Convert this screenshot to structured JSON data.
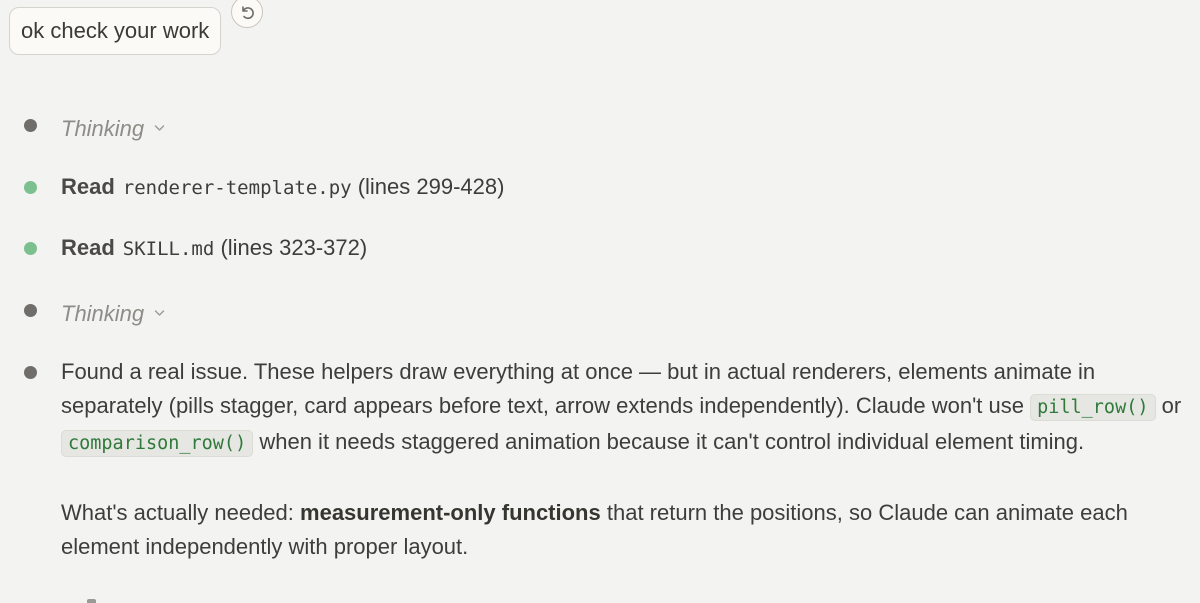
{
  "user_message": {
    "text": "ok check your work"
  },
  "steps": [
    {
      "kind": "thinking",
      "label": "Thinking"
    },
    {
      "kind": "read",
      "label": "Read",
      "file": "renderer-template.py",
      "range": "(lines 299-428)"
    },
    {
      "kind": "read",
      "label": "Read",
      "file": "SKILL.md",
      "range": "(lines 323-372)"
    },
    {
      "kind": "thinking",
      "label": "Thinking"
    }
  ],
  "response": {
    "p1_a": "Found a real issue. These helpers draw everything at once — but in actual renderers, elements animate in separately (pills stagger, card appears before text, arrow extends independently). Claude won't use",
    "code1": "pill_row()",
    "p1_b": "or",
    "code2": "comparison_row()",
    "p1_c": "when it needs staggered animation because it can't control individual element timing.",
    "p2_a": "What's actually needed:",
    "p2_bold": "measurement-only functions",
    "p2_b": "that return the positions, so Claude can animate each element independently with proper layout."
  },
  "colors": {
    "background": "#f3f3f2",
    "dot_default": "#6f6e6a",
    "dot_success": "#7cc08f",
    "code_text": "#2f7a3b"
  },
  "icons": {
    "undo": "undo-arrow-icon",
    "chevron": "chevron-down-icon"
  }
}
